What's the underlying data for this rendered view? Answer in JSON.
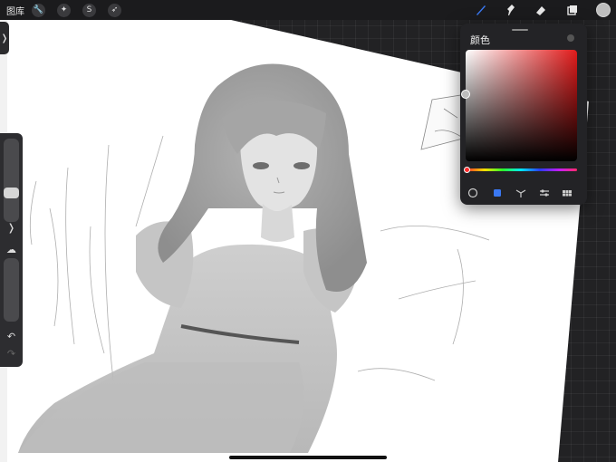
{
  "topbar": {
    "gallery_label": "图库",
    "left_tools": [
      {
        "name": "wrench-icon",
        "glyph": "🔧"
      },
      {
        "name": "magic-wand-icon",
        "glyph": "✦"
      },
      {
        "name": "selection-icon",
        "glyph": "S"
      },
      {
        "name": "transform-arrow-icon",
        "glyph": "➶"
      }
    ],
    "right_tools": [
      "brush-icon",
      "smudge-icon",
      "eraser-icon",
      "layers-icon"
    ],
    "active_color": "#bdbdbd",
    "accent_color": "#3a78f2"
  },
  "sidebar": {
    "toggle_glyph": "❭",
    "undo_glyph": "↶",
    "redo_glyph": "↷"
  },
  "color_panel": {
    "title": "颜色",
    "hue_color": "#e21b1b",
    "modes": [
      "disc-mode-icon",
      "classic-mode-icon",
      "harmony-mode-icon",
      "value-mode-icon",
      "palettes-mode-icon"
    ],
    "active_mode": "classic-mode-icon"
  }
}
